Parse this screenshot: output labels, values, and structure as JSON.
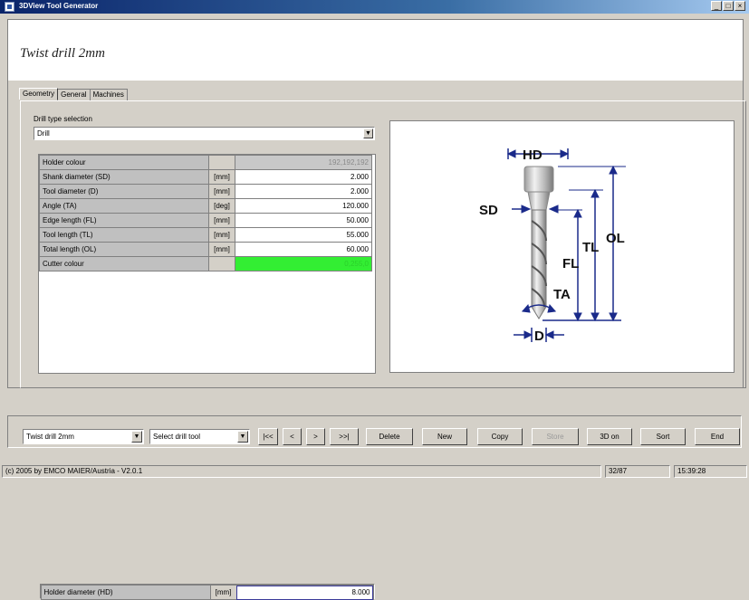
{
  "window": {
    "title": "3DView Tool Generator",
    "controls": [
      "_",
      "□",
      "×"
    ]
  },
  "tool_title": "Twist drill 2mm",
  "tabs": [
    {
      "label": "Geometry",
      "active": true
    },
    {
      "label": "General",
      "active": false
    },
    {
      "label": "Machines",
      "active": false
    }
  ],
  "drill_type": {
    "label": "Drill type selection",
    "value": "Drill"
  },
  "grid": {
    "rows": [
      {
        "name": "Holder diameter (HD)",
        "unit": "[mm]",
        "value": "8.000",
        "state": "selected"
      },
      {
        "name": "Holder colour",
        "unit": "",
        "value": "192,192,192",
        "state": "disabled"
      },
      {
        "name": "Shank diameter (SD)",
        "unit": "[mm]",
        "value": "2.000",
        "state": "normal"
      },
      {
        "name": "Tool diameter (D)",
        "unit": "[mm]",
        "value": "2.000",
        "state": "normal"
      },
      {
        "name": "Angle (TA)",
        "unit": "[deg]",
        "value": "120.000",
        "state": "normal"
      },
      {
        "name": "Edge length (FL)",
        "unit": "[mm]",
        "value": "50.000",
        "state": "normal"
      },
      {
        "name": "Tool length (TL)",
        "unit": "[mm]",
        "value": "55.000",
        "state": "normal"
      },
      {
        "name": "Total length (OL)",
        "unit": "[mm]",
        "value": "60.000",
        "state": "normal"
      },
      {
        "name": "Cutter colour",
        "unit": "",
        "value": "0,255,0",
        "state": "color",
        "color": "#33ee33"
      }
    ]
  },
  "diagram_labels": {
    "hd": "HD",
    "sd": "SD",
    "tl": "TL",
    "ol": "OL",
    "fl": "FL",
    "ta": "TA",
    "d": "D"
  },
  "toolbar": {
    "tool_select": "Twist drill 2mm",
    "type_select": "Select drill tool",
    "nav": [
      "|<<",
      "<",
      ">",
      ">>|"
    ],
    "delete": "Delete",
    "new": "New",
    "copy": "Copy",
    "store": "Store",
    "view3d": "3D on",
    "sort": "Sort",
    "end": "End"
  },
  "status": {
    "copyright": "(c) 2005 by EMCO MAIER/Austria -  V2.0.1",
    "record": "32/87",
    "time": "15:39:28"
  },
  "colors": {
    "title_bar": "#0a246a",
    "diagram_blue": "#1a2a8a",
    "cutter": "#33ee33"
  }
}
